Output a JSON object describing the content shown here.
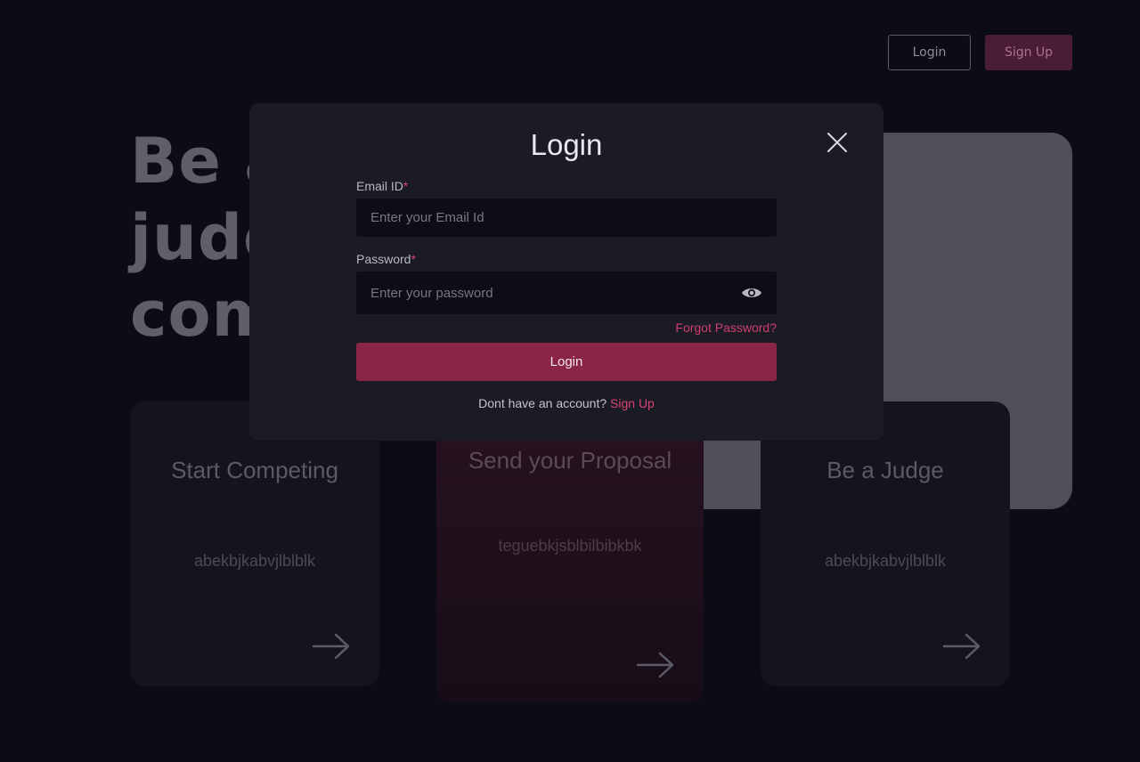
{
  "nav": {
    "login_label": "Login",
    "signup_label": "Sign Up"
  },
  "hero": {
    "title_lines": [
      "Be a",
      "judg",
      "com"
    ]
  },
  "cards": [
    {
      "title": "Start Competing",
      "text": "abekbjkabvjlblblk"
    },
    {
      "title": "Send your Proposal",
      "text": "teguebkjsblbilbibkbk"
    },
    {
      "title": "Be a Judge",
      "text": "abekbjkabvjlblblk"
    }
  ],
  "modal": {
    "title": "Login",
    "email": {
      "label": "Email ID",
      "required_mark": "*",
      "placeholder": "Enter your Email Id",
      "value": ""
    },
    "password": {
      "label": "Password",
      "required_mark": "*",
      "placeholder": "Enter your password",
      "value": ""
    },
    "forgot_label": "Forgot Password?",
    "submit_label": "Login",
    "signup_prompt": "Dont have an account?",
    "signup_link": "Sign Up"
  },
  "icons": {
    "close": "close-icon",
    "eye": "eye-icon",
    "arrow": "arrow-right-icon"
  },
  "colors": {
    "accent": "#8b2546",
    "link": "#d8446f",
    "background": "#0c0c18",
    "modal": "#1b1b26"
  }
}
